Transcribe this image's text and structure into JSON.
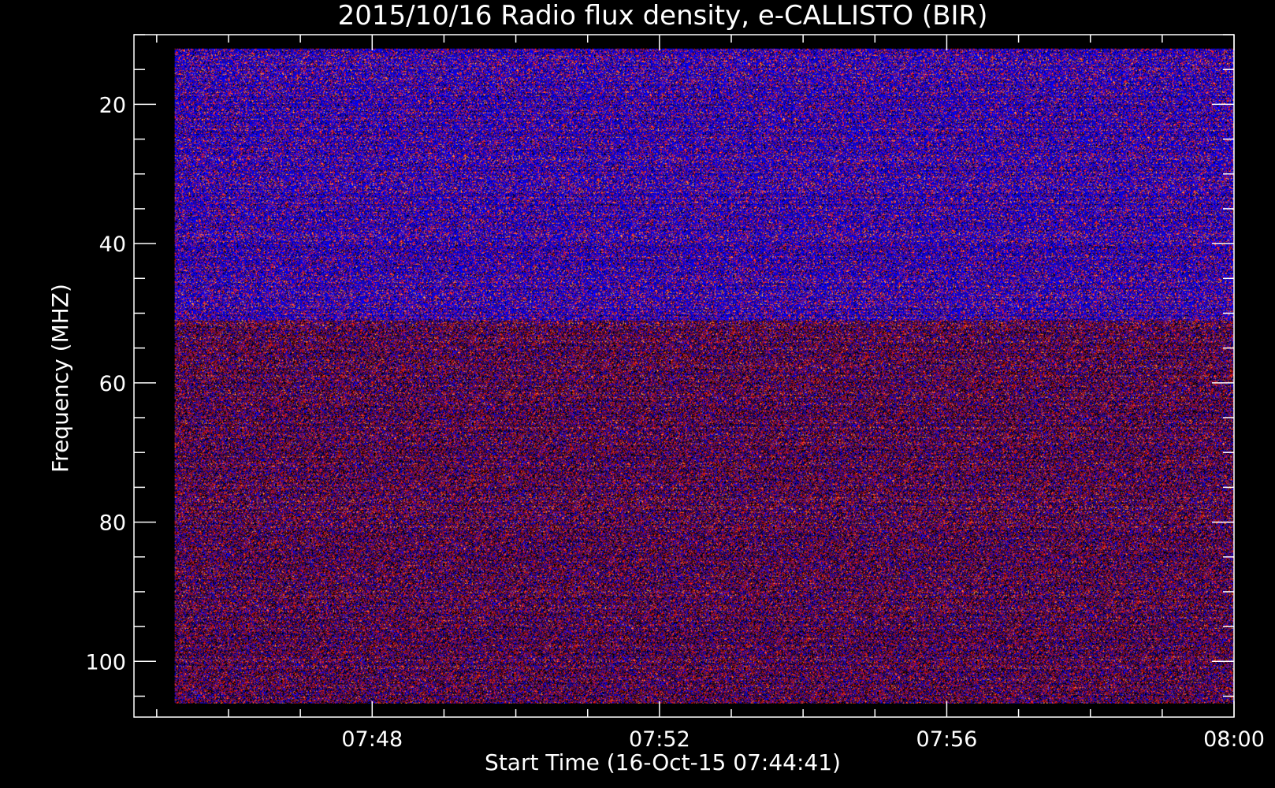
{
  "chart_data": {
    "type": "heatmap",
    "title": "2015/10/16  Radio flux density, e-CALLISTO (BIR)",
    "xlabel": "Start Time (16-Oct-15 07:44:41)",
    "ylabel": "Frequency (MHZ)",
    "x_axis": {
      "start": "07:44:41",
      "range": [
        "07:44:41",
        "08:00:00"
      ],
      "data_range": [
        "07:45:15",
        "08:00:00"
      ],
      "major_ticks": [
        "07:48",
        "07:52",
        "07:56",
        "08:00"
      ],
      "minor_tick_step_minutes": 1
    },
    "y_axis": {
      "range": [
        10,
        108
      ],
      "data_range": [
        12,
        106
      ],
      "inverted": true,
      "major_ticks": [
        20,
        40,
        60,
        80,
        100
      ],
      "minor_tick_step": 5
    },
    "bands": [
      {
        "freq_range": [
          12,
          51
        ],
        "intensity": "high",
        "color": "#3a1fff"
      },
      {
        "freq_range": [
          51,
          106
        ],
        "intensity": "low",
        "color": "#5a1050"
      }
    ],
    "colormap": [
      "#000000",
      "#2a0a80",
      "#0000ff",
      "#a01010",
      "#ff2020",
      "#ffa040"
    ],
    "colors": {
      "background": "#000000",
      "axes": "#ffffff",
      "text": "#ffffff"
    },
    "grid": false,
    "legend": "none"
  }
}
